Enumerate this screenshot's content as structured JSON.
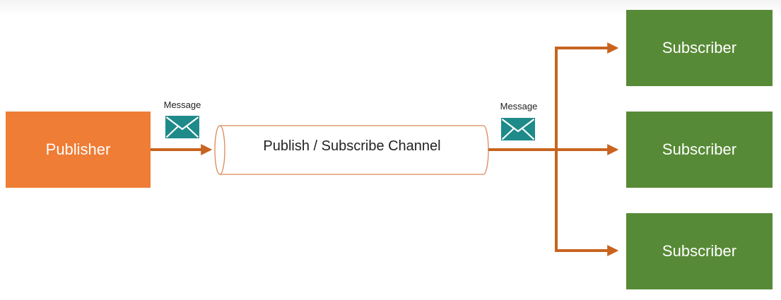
{
  "publisher": {
    "label": "Publisher"
  },
  "channel": {
    "label": "Publish / Subscribe Channel"
  },
  "messages": [
    {
      "label": "Message"
    },
    {
      "label": "Message"
    }
  ],
  "subscribers": [
    {
      "label": "Subscriber"
    },
    {
      "label": "Subscriber"
    },
    {
      "label": "Subscriber"
    }
  ],
  "colors": {
    "publisher": "#ef7d35",
    "subscriber": "#578a36",
    "arrow": "#c8641f",
    "envelope": "#1f8a8a",
    "channel_outline": "#d9895a"
  },
  "icons": {
    "message": "envelope-icon"
  }
}
